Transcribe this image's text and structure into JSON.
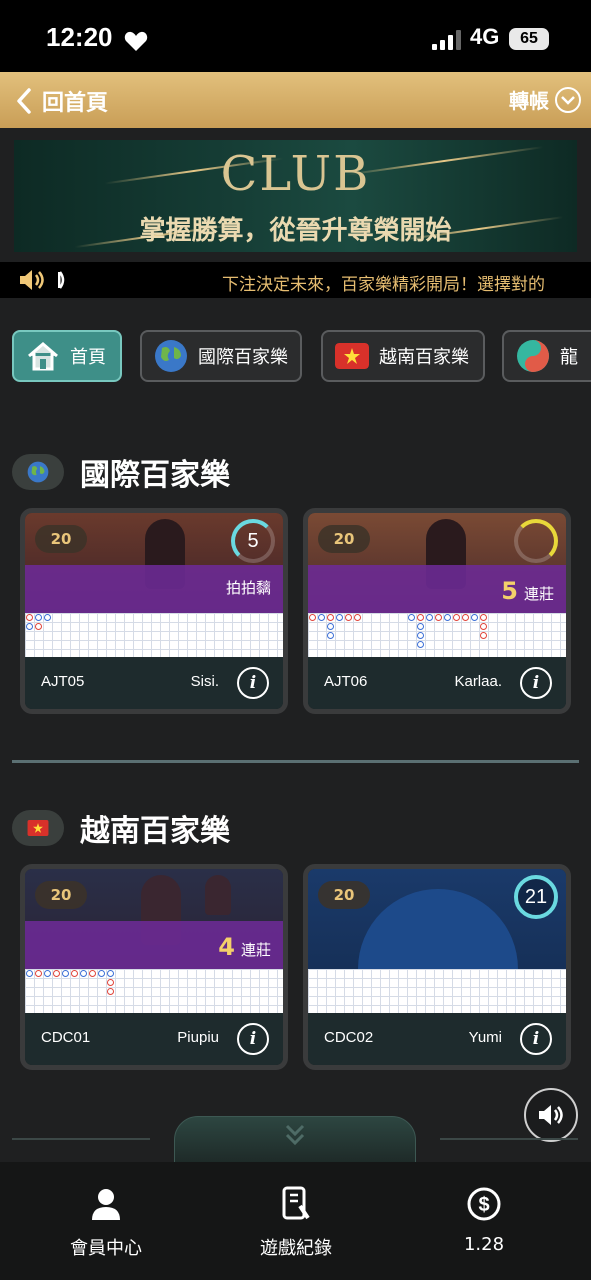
{
  "status_bar": {
    "time": "12:20",
    "network": "4G",
    "battery": "65"
  },
  "header": {
    "back_label": "回首頁",
    "transfer_label": "轉帳"
  },
  "banner": {
    "brand": "CLUB",
    "slogan": "掌握勝算，從晉升尊榮開始"
  },
  "marquee": {
    "text": "下注決定未來，百家樂精彩開局！選擇對的"
  },
  "tabs": [
    {
      "label": "首頁",
      "icon": "home-icon",
      "active": true
    },
    {
      "label": "國際百家樂",
      "icon": "globe-icon",
      "active": false
    },
    {
      "label": "越南百家樂",
      "icon": "vietnam-flag-icon",
      "active": false
    },
    {
      "label": "龍",
      "icon": "dragon-icon",
      "active": false
    }
  ],
  "sections": [
    {
      "title": "國際百家樂",
      "icon": "globe-icon",
      "tables": [
        {
          "count": "20",
          "timer": "5",
          "status_number": "",
          "status_text": "拍拍黐",
          "table_id": "AJT05",
          "dealer": "Sisi."
        },
        {
          "count": "20",
          "timer": "",
          "status_number": "5",
          "status_text": "連莊",
          "table_id": "AJT06",
          "dealer": "Karlaa."
        }
      ]
    },
    {
      "title": "越南百家樂",
      "icon": "vietnam-flag-icon",
      "tables": [
        {
          "count": "20",
          "timer": "",
          "status_number": "4",
          "status_text": "連莊",
          "table_id": "CDC01",
          "dealer": "Piupiu"
        },
        {
          "count": "20",
          "timer": "21",
          "status_number": "",
          "status_text": "",
          "table_id": "CDC02",
          "dealer": "Yumi"
        }
      ]
    }
  ],
  "bottom_nav": [
    {
      "label": "會員中心",
      "icon": "user-icon"
    },
    {
      "label": "遊戲紀錄",
      "icon": "record-icon"
    },
    {
      "label": "1.28",
      "icon": "dollar-icon"
    }
  ],
  "colors": {
    "gold": "#c99e57",
    "teal": "#3e8f88",
    "banker_red": "#e0443a",
    "player_blue": "#3b6fd6"
  }
}
